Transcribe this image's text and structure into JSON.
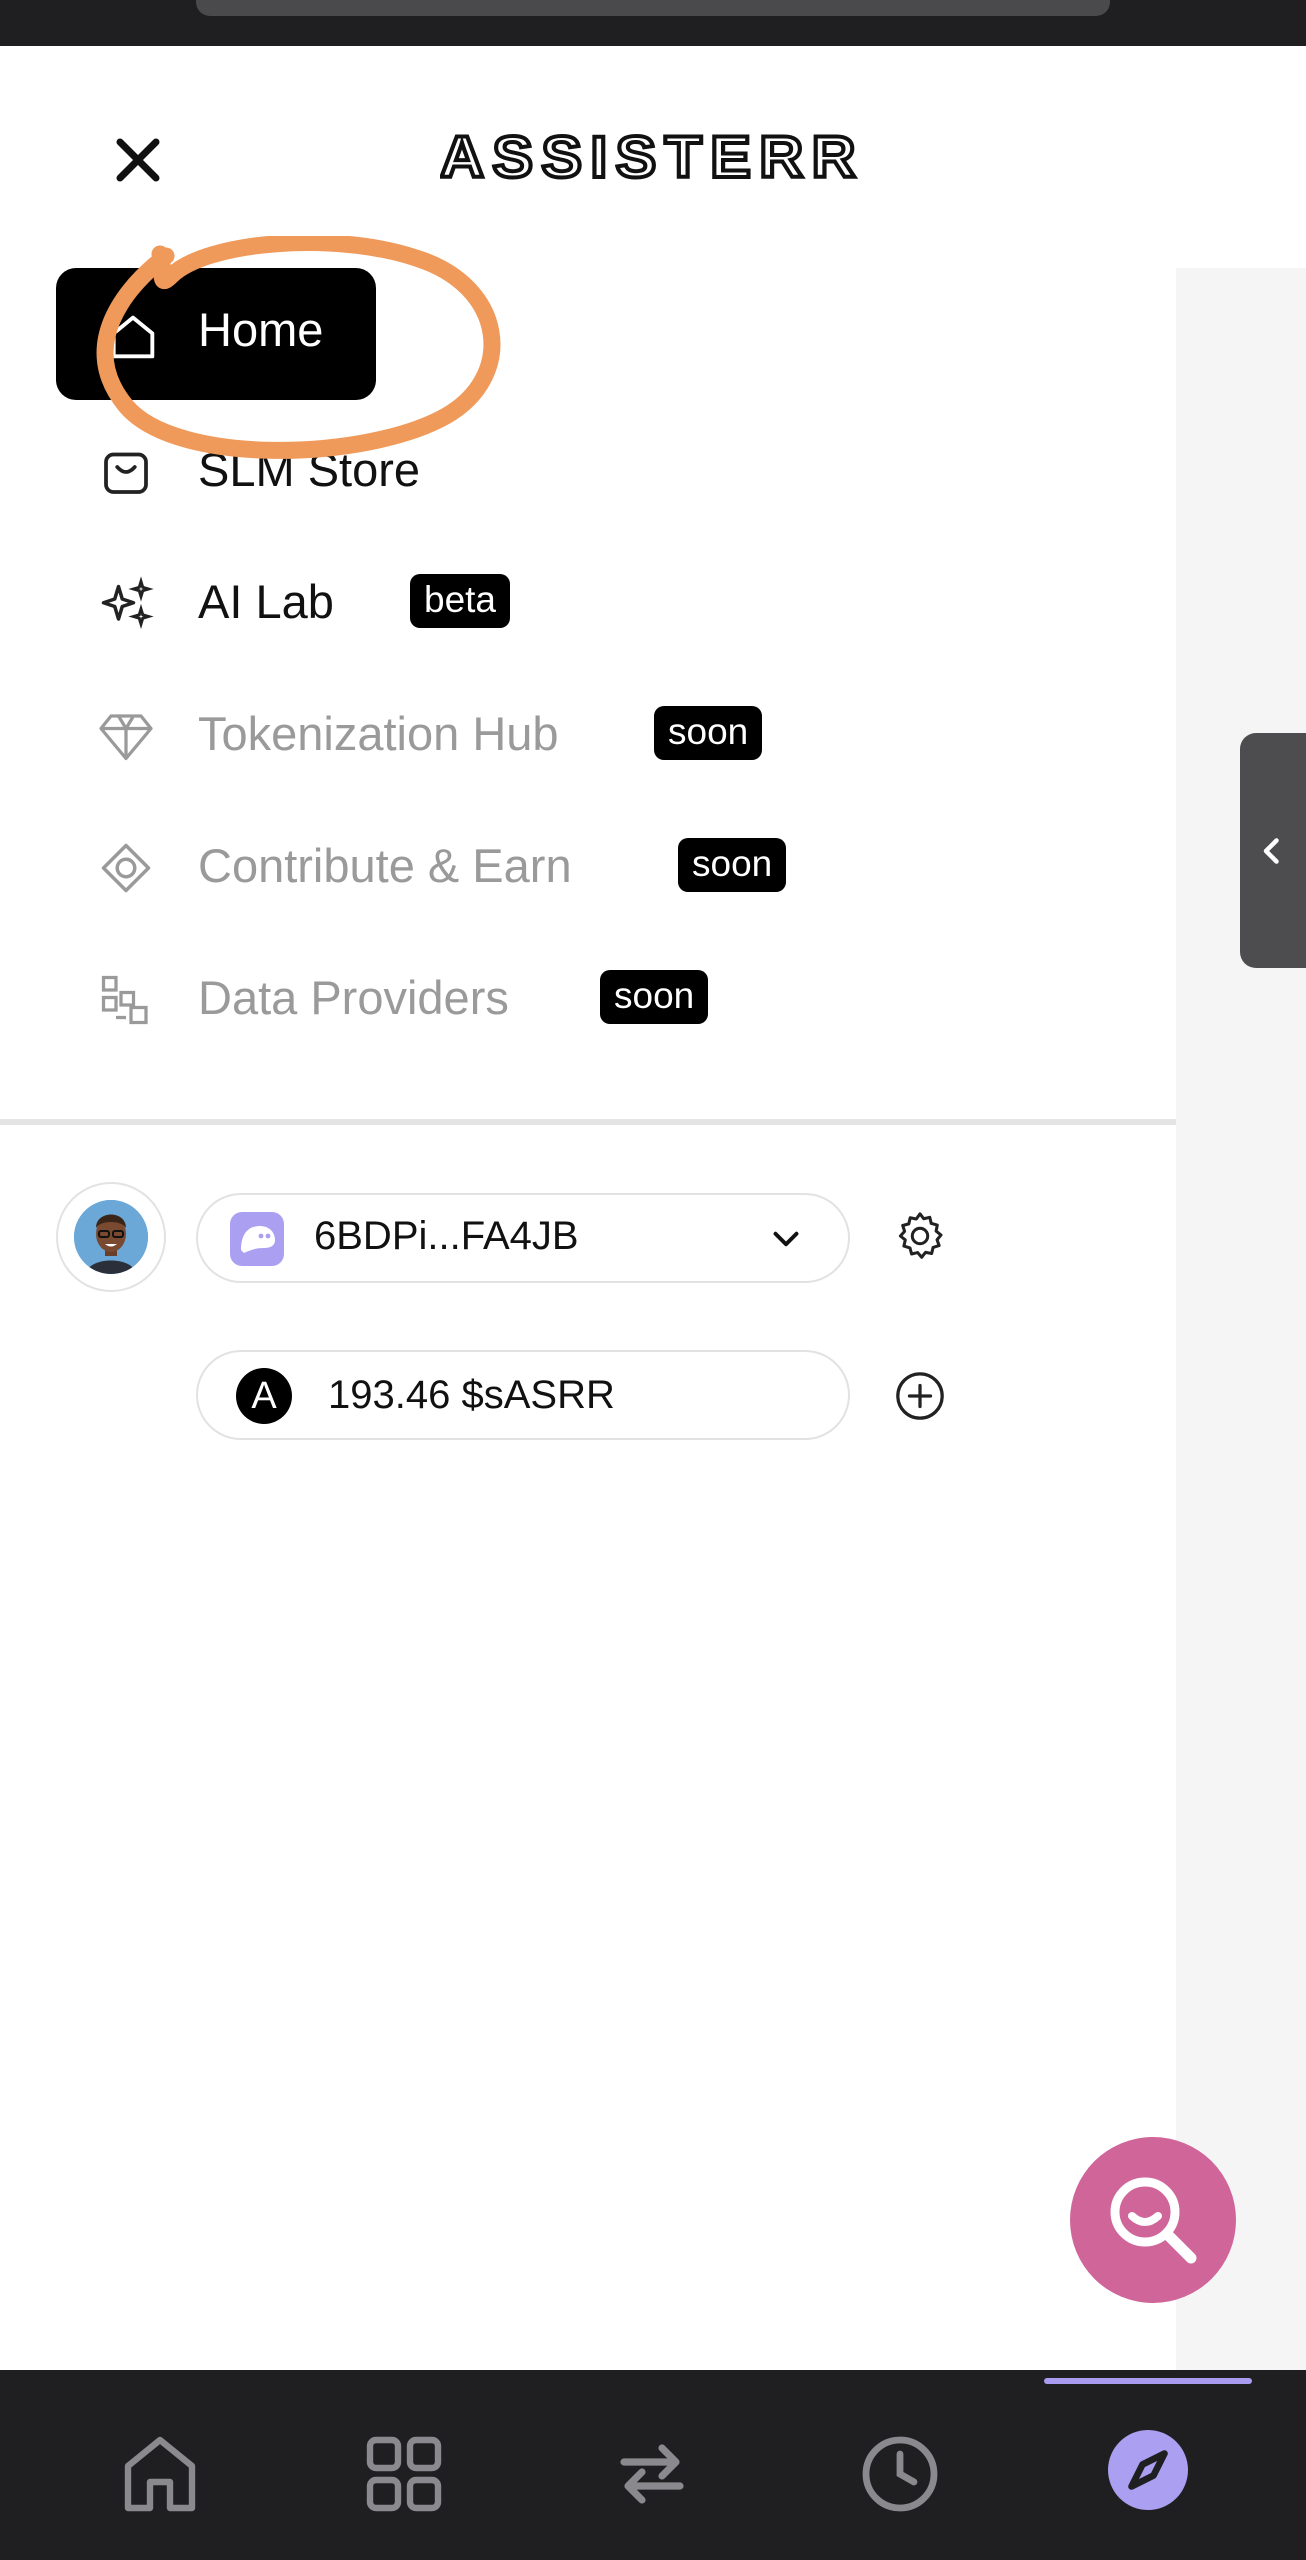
{
  "header": {
    "logo_text": "ASSISTERR",
    "close_icon": "close-icon"
  },
  "menu": {
    "items": [
      {
        "label": "Home",
        "icon": "home-outline-icon",
        "active": true
      },
      {
        "label": "SLM Store",
        "icon": "shopping-bag-icon"
      },
      {
        "label": "AI Lab",
        "icon": "sparkles-icon",
        "badge": "beta"
      },
      {
        "label": "Tokenization Hub",
        "icon": "diamond-icon",
        "badge": "soon",
        "disabled": true
      },
      {
        "label": "Contribute & Earn",
        "icon": "contribute-icon",
        "badge": "soon",
        "disabled": true
      },
      {
        "label": "Data Providers",
        "icon": "data-blocks-icon",
        "badge": "soon",
        "disabled": true
      }
    ]
  },
  "account": {
    "wallet_address": "6BDPi...FA4JB",
    "wallet_icon": "phantom-wallet-icon",
    "token_balance": "193.46 $sASRR",
    "token_symbol_letter": "A"
  },
  "annotation": {
    "color": "#ef9a5a",
    "shape": "hand-drawn circle around Home"
  },
  "bottom_nav": {
    "items": [
      {
        "icon": "home-icon"
      },
      {
        "icon": "grid-icon"
      },
      {
        "icon": "swap-arrows-icon"
      },
      {
        "icon": "clock-icon"
      },
      {
        "icon": "compass-icon",
        "active": true
      }
    ]
  },
  "colors": {
    "accent_purple": "#ab9ff2",
    "fab_pink": "#d0659a",
    "nav_background": "#1f1f21"
  }
}
